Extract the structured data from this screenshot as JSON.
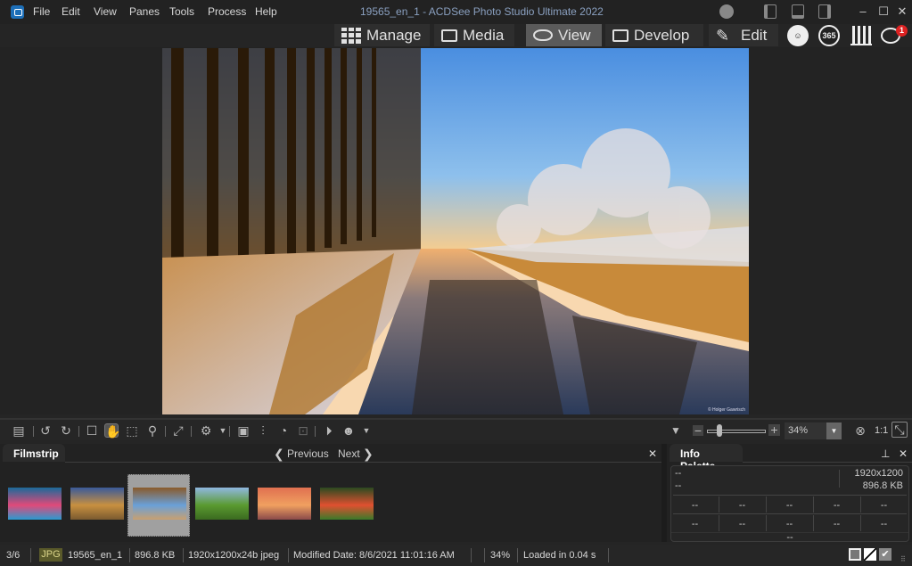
{
  "window": {
    "title": "19565_en_1 - ACDSee Photo Studio Ultimate 2022",
    "menu": [
      "File",
      "Edit",
      "View",
      "Panes",
      "Tools",
      "Process",
      "Help"
    ]
  },
  "modes": [
    {
      "label": "Manage",
      "icon": "grid-icon",
      "active": false
    },
    {
      "label": "Media",
      "icon": "media-icon",
      "active": false
    },
    {
      "label": "View",
      "icon": "eye-icon",
      "active": true
    },
    {
      "label": "Develop",
      "icon": "develop-icon",
      "active": false
    },
    {
      "label": "Edit",
      "icon": "edit-icon",
      "active": false
    }
  ],
  "extra_modes": {
    "people": "people-icon",
    "365": "365",
    "dashboard": "dashboard-icon",
    "notifications_badge": "1"
  },
  "photo": {
    "credit": "© Holger Gawrisch",
    "colors": {
      "sky_top": "#5fa0e0",
      "sky_bottom": "#f0c890",
      "water": "#3a4a6a",
      "trees": "#3a2410"
    }
  },
  "toolbar": {
    "zoom_value": "34%",
    "one_to_one": "1:1",
    "zoom_slider_fraction": 0.18
  },
  "filmstrip": {
    "tab_label": "Filmstrip",
    "previous_label": "Previous",
    "next_label": "Next",
    "thumbnails": [
      {
        "name": "coral-reef",
        "colors": [
          "#1a6a9a",
          "#e04a7a",
          "#2a9ad0"
        ]
      },
      {
        "name": "hay-bales-mountains",
        "colors": [
          "#3a5a9a",
          "#c89040",
          "#7a5a30"
        ]
      },
      {
        "name": "winter-river",
        "colors": [
          "#8a5a2a",
          "#6aa0d8",
          "#c8a070"
        ],
        "selected": true
      },
      {
        "name": "green-stream",
        "colors": [
          "#90b8e0",
          "#5a9a30",
          "#3a6a20"
        ]
      },
      {
        "name": "sunset-sea",
        "colors": [
          "#e07050",
          "#f0a060",
          "#8a4a4a"
        ]
      },
      {
        "name": "flowers",
        "colors": [
          "#2a4a20",
          "#e05030",
          "#3a7a2a"
        ]
      }
    ]
  },
  "info_palette": {
    "title": "Info Palette",
    "row1_left": "--",
    "row2_left": "--",
    "dimensions": "1920x1200",
    "size": "896.8 KB",
    "grid_row1": [
      "--",
      "--",
      "--",
      "--",
      "--"
    ],
    "grid_row2": [
      "--",
      "--",
      "--",
      "--",
      "--"
    ],
    "bottom": "--"
  },
  "status": {
    "position": "3/6",
    "format_badge": "JPG",
    "filename": "19565_en_1",
    "filesize": "896.8 KB",
    "dimensions": "1920x1200x24b jpeg",
    "modified": "Modified Date: 8/6/2021 11:01:16 AM",
    "zoom": "34%",
    "load_time": "Loaded in 0.04 s"
  }
}
